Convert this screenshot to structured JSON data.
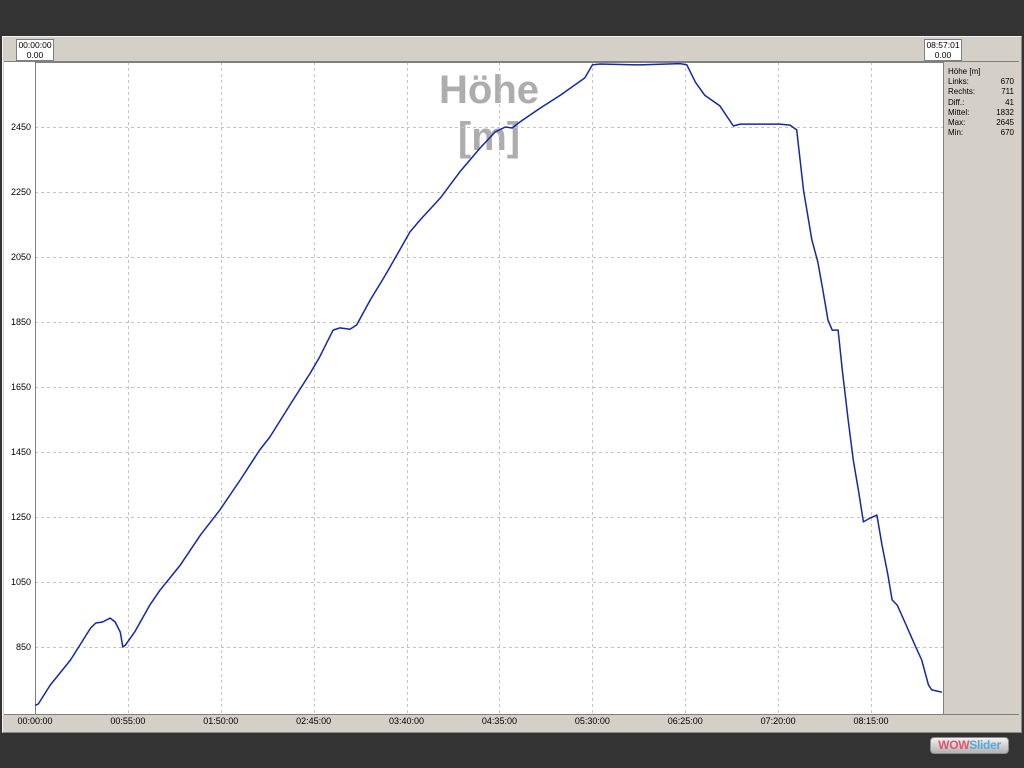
{
  "range_bar": {
    "left_handle": {
      "time": "00:00:00",
      "value": "0.00"
    },
    "right_handle": {
      "time": "08:57:01",
      "value": "0.00"
    }
  },
  "stats": {
    "header": "Höhe [m]",
    "rows": [
      {
        "label": "Links:",
        "value": "670"
      },
      {
        "label": "Rechts:",
        "value": "711"
      },
      {
        "label": "Diff.:",
        "value": "41"
      },
      {
        "label": "Mittel:",
        "value": "1832"
      },
      {
        "label": "Max:",
        "value": "2645"
      },
      {
        "label": "Min:",
        "value": "670"
      }
    ]
  },
  "colors": {
    "background": "#333333",
    "panel": "#d4d0c8",
    "plot": "#ffffff",
    "grid": "#c3c3c3",
    "line": "#1428a8",
    "title": "#adadad"
  },
  "branding": {
    "logo_part_1": "WOW",
    "logo_part_2": "Slider"
  },
  "chart_data": {
    "type": "line",
    "title": "Höhe [m]",
    "xlabel": "",
    "ylabel": "",
    "xlim": [
      "00:00:00",
      "08:57:01"
    ],
    "ylim": [
      644,
      2650
    ],
    "x_ticks": [
      "00:00:00",
      "00:55:00",
      "01:50:00",
      "02:45:00",
      "03:40:00",
      "04:35:00",
      "05:30:00",
      "06:25:00",
      "07:20:00",
      "08:15:00"
    ],
    "y_ticks": [
      850,
      1050,
      1250,
      1450,
      1650,
      1850,
      2050,
      2250,
      2450
    ],
    "grid": true,
    "series": [
      {
        "color": "#1428a8",
        "x": [
          "00:00:00",
          "00:02:00",
          "00:09:00",
          "00:21:00",
          "00:33:00",
          "00:36:00",
          "00:40:00",
          "00:44:30",
          "00:47:30",
          "00:50:30",
          "00:52:00",
          "00:53:30",
          "00:59:00",
          "01:08:00",
          "01:14:00",
          "01:26:00",
          "01:38:00",
          "01:49:30",
          "02:01:30",
          "02:13:00",
          "02:19:00",
          "02:31:00",
          "02:43:00",
          "02:48:30",
          "02:56:30",
          "03:00:30",
          "03:06:30",
          "03:10:30",
          "03:18:30",
          "03:27:30",
          "03:36:00",
          "03:42:00",
          "03:48:00",
          "04:00:00",
          "04:11:30",
          "04:23:30",
          "04:32:30",
          "04:38:30",
          "04:42:30",
          "04:47:00",
          "04:59:00",
          "05:11:00",
          "05:19:30",
          "05:25:30",
          "05:30:00",
          "05:34:30",
          "05:58:00",
          "06:22:00",
          "06:26:00",
          "06:31:00",
          "06:36:30",
          "06:45:30",
          "06:53:30",
          "06:57:30",
          "07:09:30",
          "07:21:00",
          "07:27:00",
          "07:31:00",
          "07:35:00",
          "07:37:30",
          "07:40:00",
          "07:43:30",
          "07:46:30",
          "07:49:30",
          "07:52:00",
          "07:55:30",
          "07:58:00",
          "08:01:30",
          "08:04:30",
          "08:07:30",
          "08:10:30",
          "08:14:30",
          "08:18:30",
          "08:21:30",
          "08:25:00",
          "08:27:30",
          "08:30:30",
          "08:35:00",
          "08:41:00",
          "08:45:00",
          "08:49:00",
          "08:51:00",
          "08:57:01"
        ],
        "y": [
          670,
          675,
          733,
          810,
          909,
          924,
          927,
          939,
          927,
          896,
          850,
          856,
          896,
          979,
          1025,
          1102,
          1195,
          1272,
          1364,
          1456,
          1496,
          1595,
          1693,
          1742,
          1825,
          1832,
          1828,
          1841,
          1918,
          1995,
          2072,
          2127,
          2164,
          2232,
          2312,
          2385,
          2435,
          2450,
          2447,
          2465,
          2508,
          2548,
          2579,
          2601,
          2641,
          2644,
          2641,
          2645,
          2641,
          2588,
          2548,
          2515,
          2453,
          2459,
          2459,
          2459,
          2456,
          2441,
          2256,
          2179,
          2102,
          2035,
          1948,
          1856,
          1825,
          1825,
          1702,
          1548,
          1425,
          1333,
          1235,
          1247,
          1256,
          1164,
          1072,
          995,
          979,
          927,
          856,
          810,
          733,
          718,
          711
        ]
      }
    ]
  }
}
